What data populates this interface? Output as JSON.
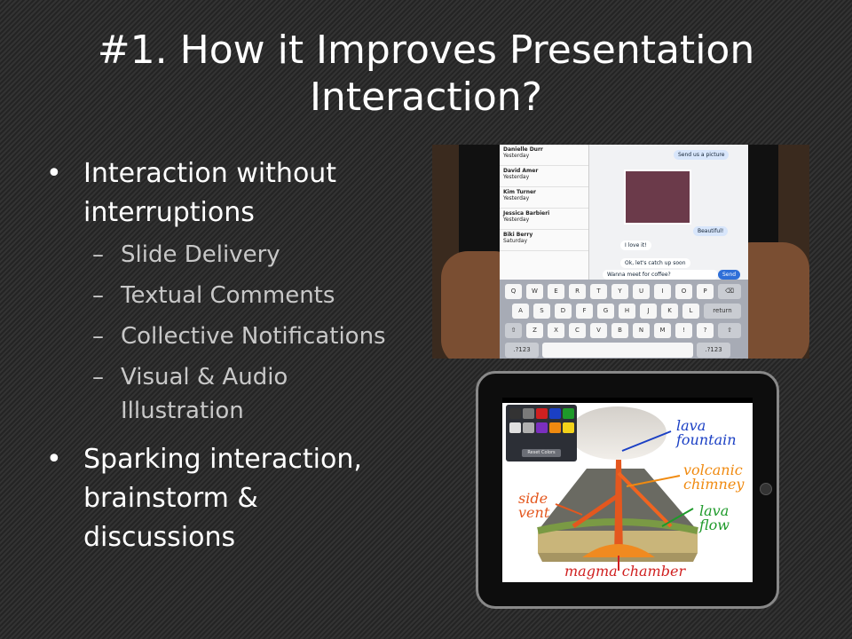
{
  "slide": {
    "title_line1": "#1. How it Improves Presentation",
    "title_line2": "Interaction?",
    "bullets": [
      {
        "text_line1": "Interaction without",
        "text_line2": "interruptions",
        "sub": [
          "Slide Delivery",
          "Textual Comments",
          "Collective Notifications"
        ],
        "sub_last_line1": "Visual & Audio",
        "sub_last_line2": "Illustration"
      },
      {
        "text_line1": "Sparking interaction,",
        "text_line2": "brainstorm &",
        "text_line3": "discussions"
      }
    ],
    "bullet_glyph": "•",
    "dash_glyph": "–"
  },
  "photo_chat": {
    "contacts": [
      {
        "name": "Danielle Durr",
        "day": "Yesterday"
      },
      {
        "name": "David Amer",
        "day": "Yesterday"
      },
      {
        "name": "Kim Turner",
        "day": "Yesterday"
      },
      {
        "name": "Jessica Barbieri",
        "day": "Yesterday"
      },
      {
        "name": "Biki Berry",
        "day": "Saturday"
      }
    ],
    "bubbles": [
      "Send us a picture",
      "Beautiful!",
      "I love it!",
      "Ok, let's catch up soon",
      "Wanna meet for coffee?"
    ],
    "send_label": "Send",
    "keys_row1": [
      "Q",
      "W",
      "E",
      "R",
      "T",
      "Y",
      "U",
      "I",
      "O",
      "P"
    ],
    "keys_row2": [
      "A",
      "S",
      "D",
      "F",
      "G",
      "H",
      "J",
      "K",
      "L"
    ],
    "keys_row3": [
      "Z",
      "X",
      "C",
      "V",
      "B",
      "N",
      "M"
    ],
    "return_label": "return",
    "numkey_label": ".?123"
  },
  "photo_volcano": {
    "labels": {
      "lava_fountain": "lava fountain",
      "volcanic_chimney": "volcanic chimney",
      "side_vent": "side vent",
      "lava_flow": "lava flow",
      "magma_chamber": "magma chamber"
    },
    "reset_label": "Reset Colors",
    "palette_colors": [
      "#333333",
      "#7a7a7a",
      "#d02020",
      "#1a3fc4",
      "#1e9a2a",
      "#e0e0e0",
      "#b0b0b0",
      "#7b2fbf",
      "#f08a10",
      "#f2d21a"
    ]
  }
}
